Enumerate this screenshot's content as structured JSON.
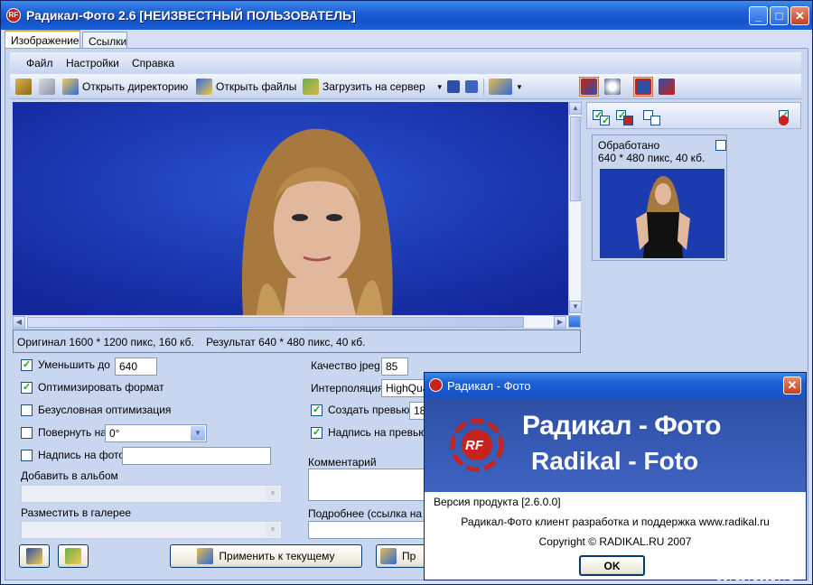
{
  "window": {
    "title": "Радикал-Фото 2.6 [НЕИЗВЕСТНЫЙ ПОЛЬЗОВАТЕЛЬ]",
    "app_icon_text": "RF"
  },
  "tabs": [
    "Изображение",
    "Ссылки"
  ],
  "menu": [
    "Файл",
    "Настройки",
    "Справка"
  ],
  "toolbar": {
    "open_dir": "Открыть директорию",
    "open_files": "Открыть файлы",
    "upload": "Загрузить на сервер"
  },
  "status": {
    "original": "Оригинал 1600 * 1200 пикс, 160 кб.",
    "result": "Результат 640 * 480 пикс, 40 кб."
  },
  "thumbnail": {
    "state": "Обработано",
    "info": "640 * 480 пикс, 40 кб."
  },
  "options": {
    "reduce_label": "Уменьшить до",
    "reduce_value": "640",
    "optimize_label": "Оптимизировать формат",
    "unconditional_label": "Безусловная оптимизация",
    "rotate_label": "Повернуть на",
    "rotate_value": "0°",
    "caption_label": "Надпись на фото",
    "caption_value": "",
    "album_label": "Добавить в альбом",
    "gallery_label": "Разместить в галерее",
    "jpeg_label": "Качество jpeg",
    "jpeg_value": "85",
    "interp_label": "Интерполяция",
    "interp_value": "HighQua",
    "preview_label": "Создать превью",
    "preview_value": "18",
    "preview_caption_label": "Надпись на превью",
    "comment_label": "Комментарий",
    "details_label": "Подробнее (ссылка на ре"
  },
  "buttons": {
    "apply_current": "Применить к текущему",
    "apply_all": "Пр"
  },
  "about": {
    "title": "Радикал - Фото",
    "logo_text": "RF",
    "banner_ru": "Радикал - Фото",
    "banner_en": "Radikal - Foto",
    "version": "Версия продукта [2.6.0.0]",
    "description": "Радикал-Фото клиент разработка и поддержка www.radikal.ru",
    "copyright": "Copyright © RADIKAL.RU 2007",
    "ok": "OK"
  },
  "watermark": "sorus.ucoz.ru",
  "colors": {
    "titlebar": "#1d5fd4",
    "panel": "#c9d6f0",
    "photo_bg": "#1b3cae",
    "logo_red": "#c8221c"
  }
}
